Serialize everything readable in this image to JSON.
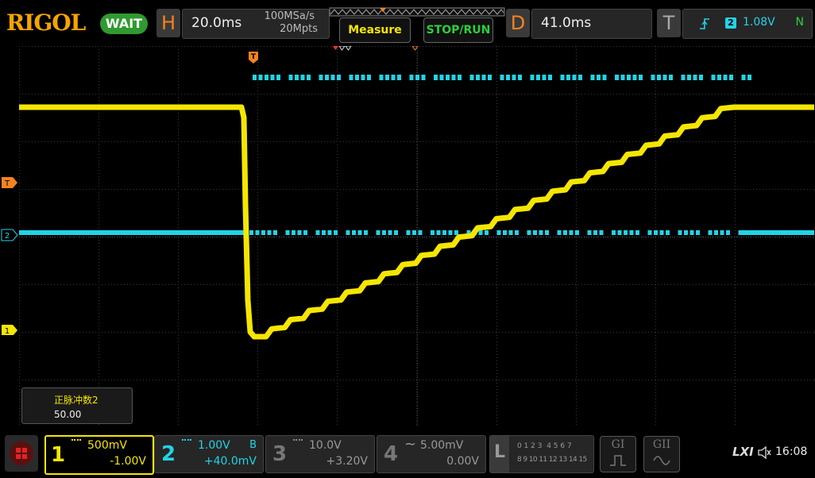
{
  "brand": {
    "logo": "RIGOL",
    "status": "WAIT"
  },
  "horizontal": {
    "letter": "H",
    "timebase": "20.0ms",
    "sample_rate": "100MSa/s",
    "memory_depth": "20Mpts"
  },
  "buttons": {
    "measure": "Measure",
    "stop_run": "STOP/RUN"
  },
  "delay": {
    "letter": "D",
    "value": "41.0ms"
  },
  "trigger": {
    "letter": "T",
    "source": "2",
    "level": "1.08V",
    "mode": "N"
  },
  "markers": {
    "trigger": "T",
    "ch1": "1",
    "ch2": "2"
  },
  "measurement": {
    "label": "正脉冲数2",
    "value": "50.00"
  },
  "channels": [
    {
      "num": "1",
      "scale": "500mV",
      "offset": "-1.00V",
      "coupling": ""
    },
    {
      "num": "2",
      "scale": "1.00V",
      "offset": "+40.0mV",
      "coupling": "B"
    },
    {
      "num": "3",
      "scale": "10.0V",
      "offset": "+3.20V",
      "coupling": ""
    },
    {
      "num": "4",
      "scale": "5.00mV",
      "offset": "0.00V",
      "coupling": ""
    }
  ],
  "logic": {
    "letter": "L",
    "row1": "0 1 2 3  4 5 6 7",
    "row2": "8 9 10 11 12 13 14 15"
  },
  "generators": {
    "g1": "GI",
    "g2": "GII"
  },
  "system": {
    "lxi": "LXI",
    "time": "16:08"
  },
  "colors": {
    "ch1": "#f5e600",
    "ch2": "#22d3e6",
    "trigger": "#f58220",
    "accent": "#2f9a2f"
  }
}
